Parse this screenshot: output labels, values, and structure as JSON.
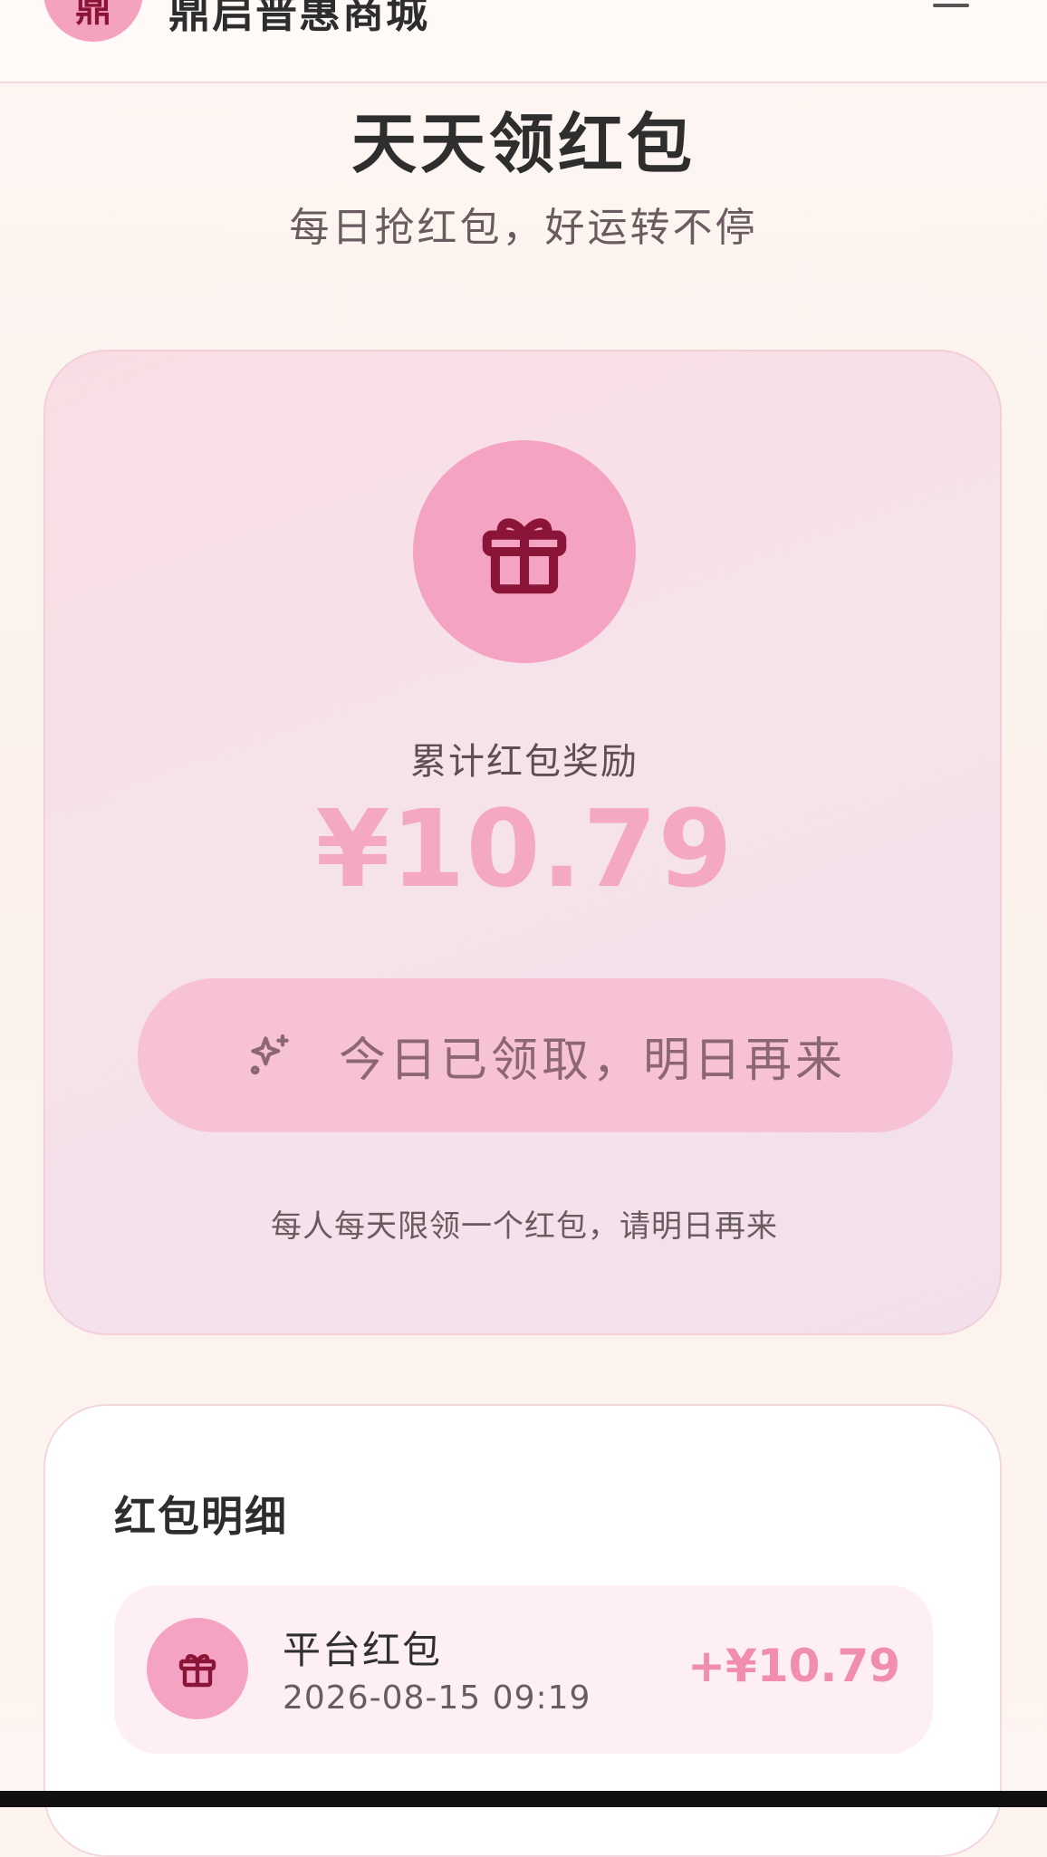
{
  "header": {
    "logo_char": "鼎",
    "brand": "鼎启普惠商城",
    "menu_icon": "menu-icon"
  },
  "page": {
    "title": "天天领红包",
    "subtitle": "每日抢红包，好运转不停"
  },
  "reward_card": {
    "icon": "gift-icon",
    "label": "累计红包奖励",
    "amount": "¥10.79",
    "button_icon": "sparkle-icon",
    "button_label": "今日已领取，明日再来",
    "note": "每人每天限领一个红包，请明日再来"
  },
  "details": {
    "title": "红包明细",
    "records": [
      {
        "icon": "gift-icon",
        "name": "平台红包",
        "time": "2026-08-15 09:19",
        "amount": "+¥10.79"
      }
    ]
  },
  "colors": {
    "accent_pink": "#f5a3c2",
    "icon_dark": "#8a1538",
    "amount_pink": "#f4a8c2",
    "record_amount": "#f08db0"
  }
}
